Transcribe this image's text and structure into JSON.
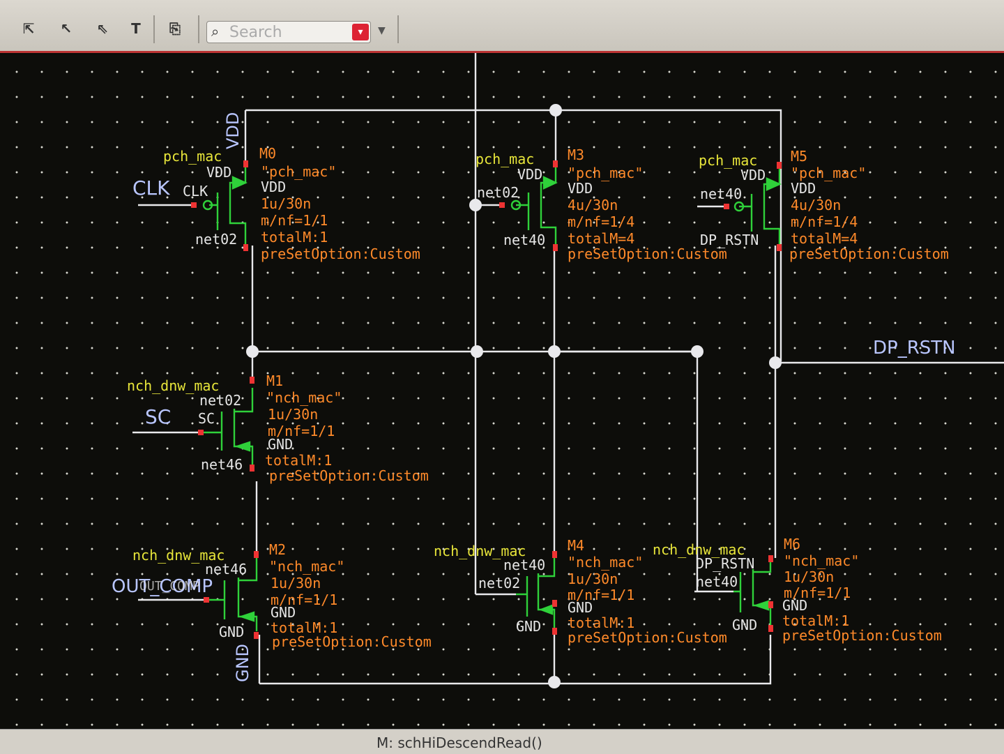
{
  "toolbar": {
    "search_placeholder": "Search",
    "icons": [
      "select-pin-icon",
      "select-wire-icon",
      "select-instance-icon",
      "select-text-icon",
      "copy-select-icon"
    ]
  },
  "status": {
    "text": "M: schHiDescendRead()"
  },
  "pins": {
    "clk": "CLK",
    "sc": "SC",
    "out_comp": "OUT_COMP",
    "dp_rstn": "DP_RSTN"
  },
  "rails": {
    "vdd": "VDD",
    "gnd": "GND"
  },
  "devices": {
    "m0": {
      "cell": "pch_mac",
      "name": "M0",
      "model": "\"pch_mac\"",
      "bulk": "VDD",
      "size": "1u/30n",
      "mnf": "m/nf=1/1",
      "total": "totalM:1",
      "preset": "preSetOption:Custom",
      "t_s": "VDD",
      "t_g": "CLK",
      "t_d": "net02"
    },
    "m1": {
      "cell": "nch_dnw_mac",
      "name": "M1",
      "model": "\"nch_mac\"",
      "bulk": "GND",
      "size": "1u/30n",
      "mnf": "m/nf=1/1",
      "total": "totalM:1",
      "preset": "preSetOption:Custom",
      "t_d": "net02",
      "t_g": "SC",
      "t_s": "net46"
    },
    "m2": {
      "cell": "nch_dnw_mac",
      "name": "M2",
      "model": "\"nch_mac\"",
      "bulk": "GND",
      "size": "1u/30n",
      "mnf": "m/nf=1/1",
      "total": "totalM:1",
      "preset": "preSetOption:Custom",
      "t_d": "net46",
      "t_g": "OUT_COMP",
      "t_s": "GND"
    },
    "m3": {
      "cell": "pch_mac",
      "name": "M3",
      "model": "\"pch_mac\"",
      "bulk": "VDD",
      "size": "4u/30n",
      "mnf": "m/nf=1/4",
      "total": "totalM=4",
      "preset": "preSetOption:Custom",
      "t_s": "VDD",
      "t_g": "net02",
      "t_d": "net40"
    },
    "m4": {
      "cell": "nch_dnw_mac",
      "name": "M4",
      "model": "\"nch_mac\"",
      "bulk": "GND",
      "size": "1u/30n",
      "mnf": "m/nf=1/1",
      "total": "totalM:1",
      "preset": "preSetOption:Custom",
      "t_d": "net40",
      "t_g": "net02",
      "t_s": "GND"
    },
    "m5": {
      "cell": "pch_mac",
      "name": "M5",
      "model": "\"pch_mac\"",
      "bulk": "VDD",
      "size": "4u/30n",
      "mnf": "m/nf=1/4",
      "total": "totalM=4",
      "preset": "preSetOption:Custom",
      "t_s": "VDD",
      "t_g": "net40",
      "t_d": "DP_RSTN"
    },
    "m6": {
      "cell": "nch_dnw_mac",
      "name": "M6",
      "model": "\"nch_mac\"",
      "bulk": "GND",
      "size": "1u/30n",
      "mnf": "m/nf=1/1",
      "total": "totalM:1",
      "preset": "preSetOption:Custom",
      "t_d": "DP_RSTN",
      "t_g": "net40",
      "t_s": "GND"
    }
  }
}
